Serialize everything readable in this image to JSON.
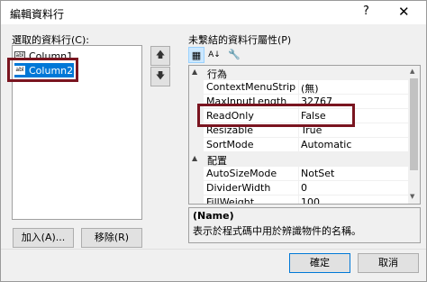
{
  "window": {
    "title": "編輯資料行",
    "help": "?",
    "close": "✕"
  },
  "left": {
    "label": "選取的資料行(C):",
    "columns": [
      {
        "label": "Column1",
        "icon_text": "abl",
        "selected": false
      },
      {
        "label": "Column2",
        "icon_text": "abl",
        "selected": true
      }
    ],
    "move_up": "🡅",
    "move_down": "🡇",
    "add_label": "加入(A)...",
    "remove_label": "移除(R)"
  },
  "right": {
    "label": "未繫結的資料行屬性(P)",
    "toolbar": [
      {
        "name": "categorized-icon",
        "glyph": "▦",
        "active": true
      },
      {
        "name": "alphabetical-icon",
        "glyph": "A↓",
        "active": false
      },
      {
        "name": "property-pages-icon",
        "glyph": "🔧",
        "active": false
      }
    ],
    "categories": [
      {
        "name": "行為",
        "toggle": "▲",
        "rows": [
          {
            "name": "ContextMenuStrip",
            "value": "(無)"
          },
          {
            "name": "MaxInputLength",
            "value": "32767"
          },
          {
            "name": "ReadOnly",
            "value": "False"
          },
          {
            "name": "Resizable",
            "value": "True"
          },
          {
            "name": "SortMode",
            "value": "Automatic"
          }
        ]
      },
      {
        "name": "配置",
        "toggle": "▲",
        "rows": [
          {
            "name": "AutoSizeMode",
            "value": "NotSet"
          },
          {
            "name": "DividerWidth",
            "value": "0"
          },
          {
            "name": "FillWeight",
            "value": "100"
          }
        ]
      }
    ],
    "description": {
      "title": "(Name)",
      "text": "表示於程式碼中用於辨識物件的名稱。"
    }
  },
  "buttons": {
    "ok_label": "確定",
    "cancel_label": "取消"
  }
}
